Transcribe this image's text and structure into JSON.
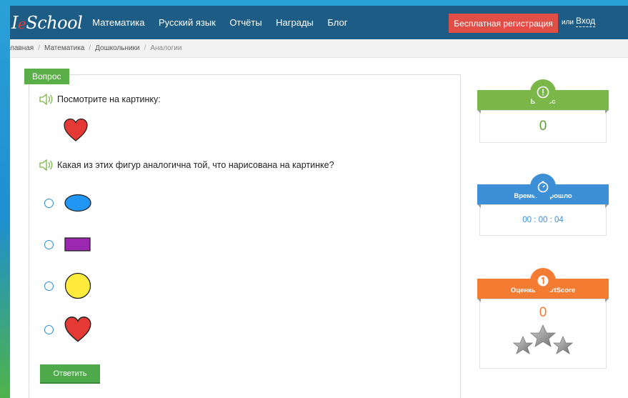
{
  "header": {
    "logo_prefix": "I",
    "logo_e": "e",
    "logo_rest": "School",
    "nav": [
      "Математика",
      "Русский язык",
      "Отчёты",
      "Награды",
      "Блог"
    ],
    "register_label": "Бесплатная регистрация",
    "or_label": "или",
    "login_label": "Вход"
  },
  "breadcrumb": {
    "items": [
      "лавная",
      "Математика",
      "Дошкольники"
    ],
    "current": "Аналогии"
  },
  "question": {
    "tab_label": "Вопрос",
    "prompt1": "Посмотрите на картинку:",
    "prompt2": "Какая из этих фигур аналогична той, что нарисована на картинке?",
    "options": [
      "blue-oval",
      "purple-rectangle",
      "yellow-circle",
      "red-heart"
    ],
    "answer_button": "Ответить"
  },
  "widgets": {
    "question": {
      "title": "Вопрос",
      "value": "0",
      "color": "#7ab648"
    },
    "time": {
      "title": "Времени прошло",
      "value": "00 : 00 : 04",
      "color": "#3d8fd6"
    },
    "score": {
      "title": "Оценка SmartScore",
      "value": "0",
      "color": "#f47b32"
    }
  },
  "colors": {
    "topbar": "#1d5c84",
    "register": "#e04e46",
    "answer": "#4ea94a",
    "heart": "#e53935",
    "oval": "#2196f3",
    "rectangle": "#9c27b0",
    "circle": "#ffeb3b"
  }
}
